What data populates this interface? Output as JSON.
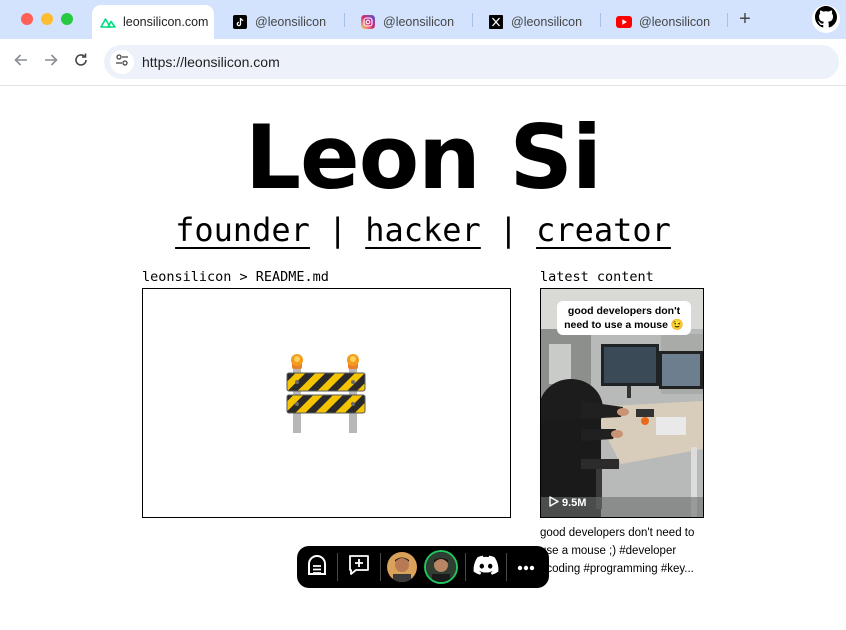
{
  "browser": {
    "tabs": [
      {
        "label": "leonsilicon.com",
        "icon": "nuxt-icon",
        "active": true
      },
      {
        "label": "@leonsilicon",
        "icon": "tiktok-icon",
        "active": false
      },
      {
        "label": "@leonsilicon",
        "icon": "instagram-icon",
        "active": false
      },
      {
        "label": "@leonsilicon",
        "icon": "x-icon",
        "active": false
      },
      {
        "label": "@leonsilicon",
        "icon": "youtube-icon",
        "active": false
      }
    ],
    "new_tab_label": "+",
    "url": "https://leonsilicon.com"
  },
  "page": {
    "title": "Leon Si",
    "roles": [
      "founder",
      "hacker",
      "creator"
    ],
    "separator": "|",
    "readme_label": "leonsilicon > README.md",
    "latest_label": "latest content",
    "latest": {
      "overlay_caption": "good developers don't need to use a mouse 😉",
      "views": "9.5M",
      "description": "good developers don't need to use a mouse ;) #developer #coding #programming #key..."
    }
  },
  "toolbar_pill": {
    "items": [
      "logo-icon",
      "comment-icon",
      "avatar-1",
      "avatar-2",
      "discord-icon",
      "more-icon"
    ]
  },
  "colors": {
    "tabbar_bg": "#d3e3fd",
    "omnibox_bg": "#edf2fa",
    "pill_bg": "#000000",
    "avatar_ring": "#22c55e"
  }
}
